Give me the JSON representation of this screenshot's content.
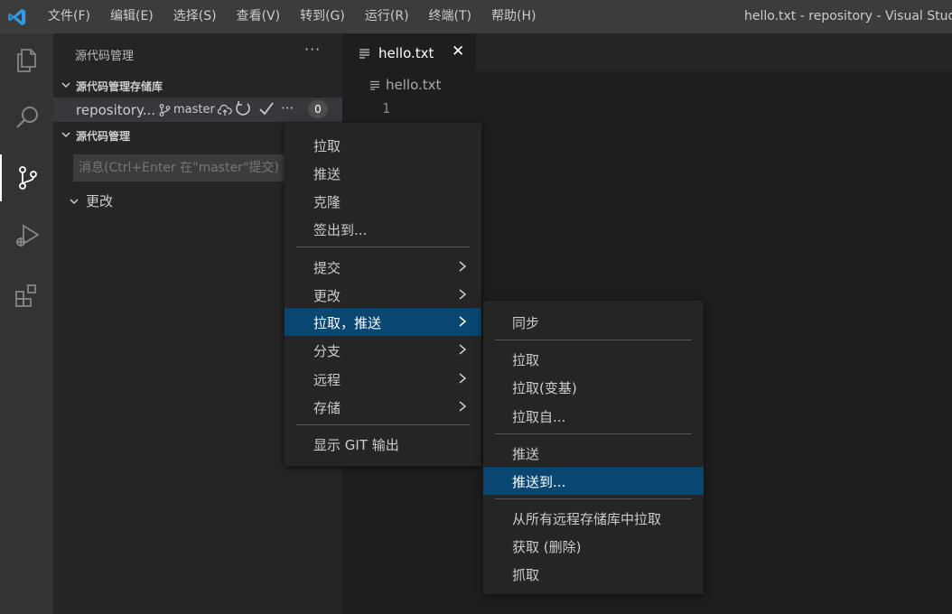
{
  "menubar": {
    "items": [
      "文件(F)",
      "编辑(E)",
      "选择(S)",
      "查看(V)",
      "转到(G)",
      "运行(R)",
      "终端(T)",
      "帮助(H)"
    ]
  },
  "window": {
    "title": "hello.txt - repository - Visual Studio"
  },
  "sidebar": {
    "title": "源代码管理",
    "more": "···",
    "repos_section": "源代码管理存储库",
    "repo": {
      "name": "repository...",
      "branch": "master",
      "more": "···",
      "badge": "0"
    },
    "scm_section": "源代码管理",
    "commit_placeholder": "消息(Ctrl+Enter 在\"master\"提交)",
    "changes_label": "更改"
  },
  "editor": {
    "tab_label": "hello.txt",
    "close_glyph": "✕",
    "breadcrumb": "hello.txt",
    "line_number": "1"
  },
  "context_menu": {
    "items": [
      {
        "label": "拉取"
      },
      {
        "label": "推送"
      },
      {
        "label": "克隆"
      },
      {
        "label": "签出到..."
      },
      {
        "label": "提交",
        "submenu": true
      },
      {
        "label": "更改",
        "submenu": true
      },
      {
        "label": "拉取，推送",
        "submenu": true,
        "highlighted": true
      },
      {
        "label": "分支",
        "submenu": true
      },
      {
        "label": "远程",
        "submenu": true
      },
      {
        "label": "存储",
        "submenu": true
      },
      {
        "label": "显示 GIT 输出"
      }
    ]
  },
  "submenu": {
    "items": [
      {
        "label": "同步"
      },
      {
        "label": "拉取"
      },
      {
        "label": "拉取(变基)"
      },
      {
        "label": "拉取自..."
      },
      {
        "label": "推送"
      },
      {
        "label": "推送到...",
        "highlighted": true
      },
      {
        "label": "从所有远程存储库中拉取"
      },
      {
        "label": "获取 (删除)"
      },
      {
        "label": "抓取"
      }
    ]
  },
  "colors": {
    "accent": "#007acc",
    "highlight": "#094771",
    "titlebar": "#3c3c3c",
    "activitybar": "#333333",
    "sidebar": "#252526",
    "editor": "#1e1e1e"
  }
}
